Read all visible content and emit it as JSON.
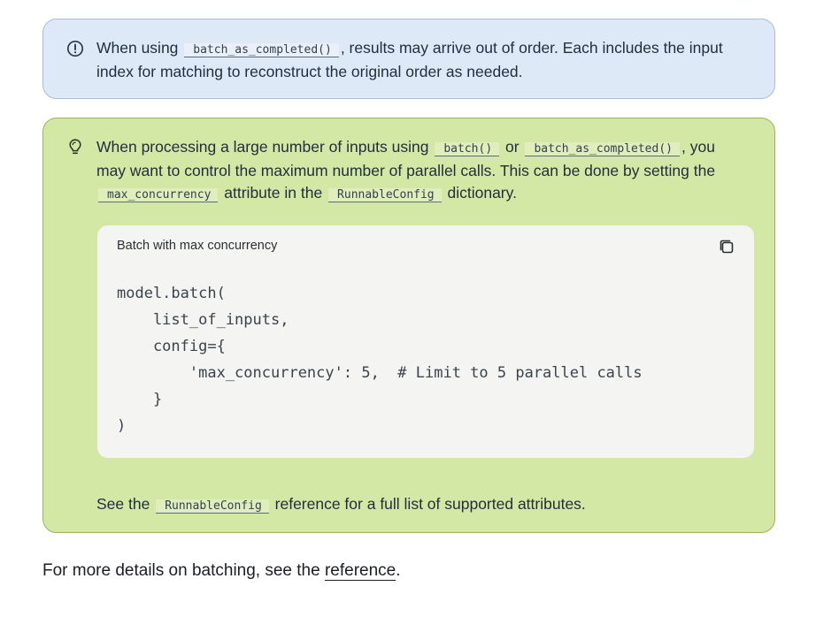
{
  "note": {
    "icon": "info-circle-icon",
    "text_before": "When using ",
    "code": "batch_as_completed()",
    "text_after": ", results may arrive out of order. Each includes the input index for matching to reconstruct the original order as needed."
  },
  "tip": {
    "icon": "lightbulb-icon",
    "p1_a": "When processing a large number of inputs using ",
    "p1_code1": "batch()",
    "p1_b": " or ",
    "p1_code2": "batch_as_completed()",
    "p1_c": ", you may want to control the maximum number of parallel calls. This can be done by setting the ",
    "p1_code3": "max_concurrency",
    "p1_d": " attribute in the ",
    "p1_code4": "RunnableConfig",
    "p1_e": " dictionary.",
    "code_block": {
      "title": "Batch with max concurrency",
      "copy_icon": "copy-icon",
      "code": "model.batch(\n    list_of_inputs,\n    config={\n        'max_concurrency': 5,  # Limit to 5 parallel calls\n    }\n)"
    },
    "p2_a": "See the ",
    "p2_code": "RunnableConfig",
    "p2_b": " reference for a full list of supported attributes."
  },
  "footer": {
    "text_before": "For more details on batching, see the ",
    "link": "reference",
    "text_after": "."
  },
  "colors": {
    "note_bg": "#dde9f7",
    "tip_bg": "#d4e8a6",
    "code_bg": "#f4f4f2"
  }
}
